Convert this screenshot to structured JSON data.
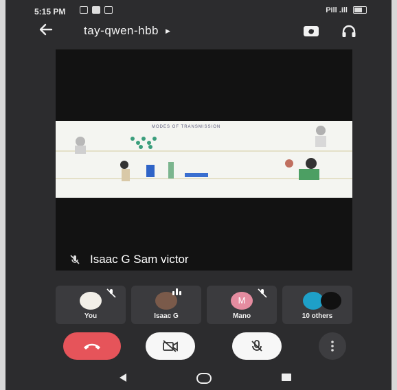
{
  "status_bar": {
    "time": "5:15 PM",
    "right_text": "Pill .ill"
  },
  "header": {
    "meeting_code": "tay-qwen-hbb",
    "caret_icon": "caret-right-icon",
    "switch_camera_icon": "switch-camera-icon",
    "audio_icon": "headphones-icon",
    "back_icon": "arrow-left-icon"
  },
  "stage": {
    "slide_heading": "MODES OF TRANSMISSION",
    "speaker_name": "Isaac G Sam victor"
  },
  "participants": [
    {
      "label": "You",
      "muted": true
    },
    {
      "label": "Isaac G",
      "muted": false
    },
    {
      "label": "Mano",
      "initial": "M",
      "muted": true
    },
    {
      "label": "10 others",
      "muted": false
    }
  ],
  "controls": {
    "end_call_color": "#e6545a",
    "button_light": "#f7f7f7"
  }
}
